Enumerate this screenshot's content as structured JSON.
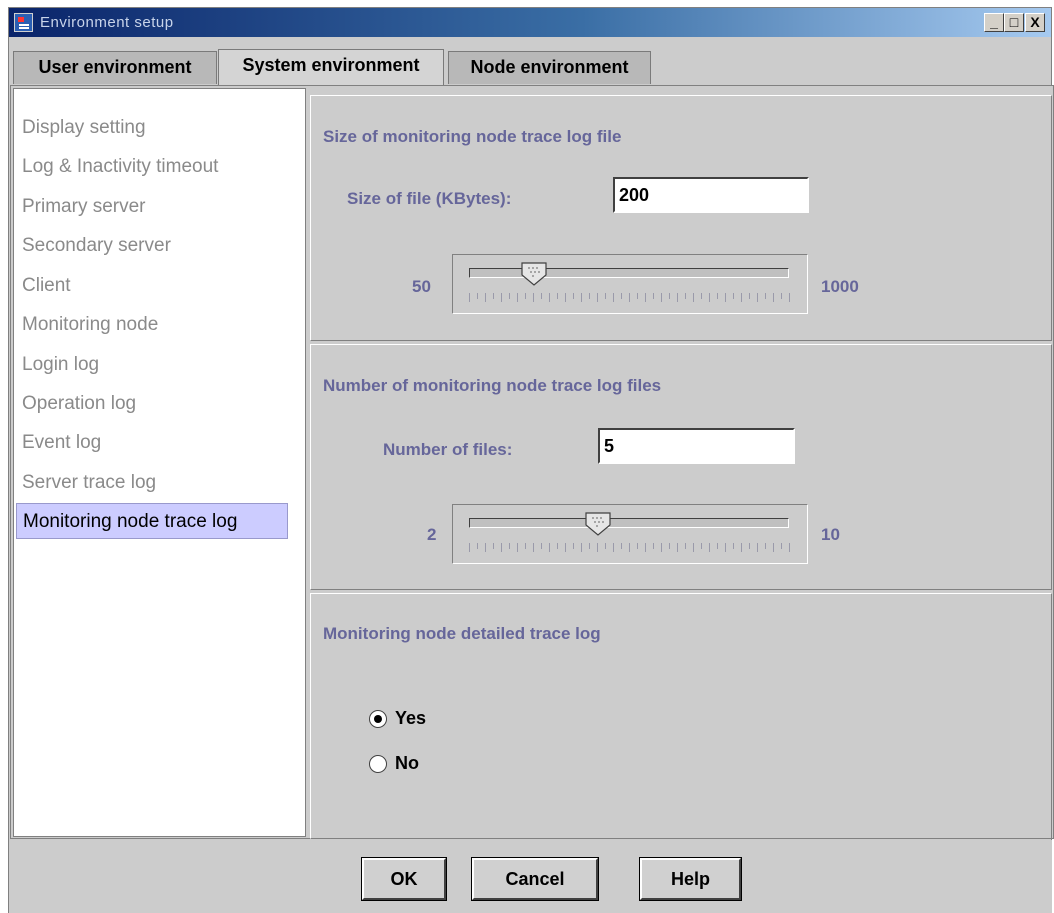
{
  "window": {
    "title": "Environment setup",
    "controls": {
      "minimize": "_",
      "maximize": "□",
      "close": "X"
    }
  },
  "tabs": [
    {
      "label": "User environment",
      "active": false
    },
    {
      "label": "System environment",
      "active": true
    },
    {
      "label": "Node environment",
      "active": false
    }
  ],
  "sidebar": {
    "items": [
      {
        "label": "Display setting"
      },
      {
        "label": "Log & Inactivity timeout"
      },
      {
        "label": "Primary server"
      },
      {
        "label": "Secondary server"
      },
      {
        "label": "Client"
      },
      {
        "label": "Monitoring node"
      },
      {
        "label": "Login log"
      },
      {
        "label": "Operation log"
      },
      {
        "label": "Event log"
      },
      {
        "label": "Server trace log"
      },
      {
        "label": "Monitoring node trace log",
        "selected": true
      }
    ]
  },
  "size_panel": {
    "title": "Size of monitoring node trace log file",
    "field_label": "Size of file (KBytes):",
    "field_value": "200",
    "slider": {
      "min": "50",
      "max": "1000",
      "value": 200
    }
  },
  "count_panel": {
    "title": "Number of monitoring node trace log files",
    "field_label": "Number of files:",
    "field_value": "5",
    "slider": {
      "min": "2",
      "max": "10",
      "value": 5
    }
  },
  "detail_panel": {
    "title": "Monitoring node detailed trace log",
    "options": [
      {
        "label": "Yes",
        "checked": true
      },
      {
        "label": "No",
        "checked": false
      }
    ]
  },
  "buttons": {
    "ok": "OK",
    "cancel": "Cancel",
    "help": "Help"
  },
  "colors": {
    "panel_label": "#66669a",
    "selected_item": "#ccccff",
    "title_bar": "#0a246a"
  }
}
